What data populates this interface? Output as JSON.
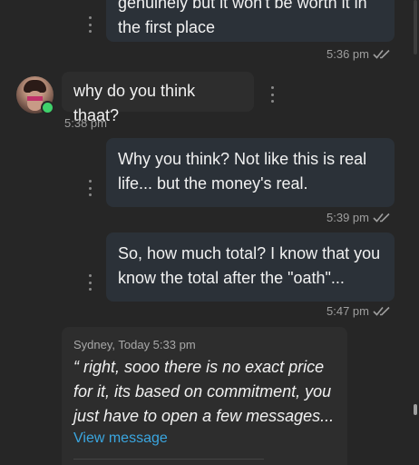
{
  "messages": [
    {
      "id": "m1",
      "direction": "outgoing",
      "text": "genuinely but it won't be worth it in\nthe first place",
      "time": "5:36 pm",
      "status": "read"
    },
    {
      "id": "m2",
      "direction": "incoming",
      "text": "why do you think thaat?",
      "time": "5:38 pm"
    },
    {
      "id": "m3",
      "direction": "outgoing",
      "text": "Why you think? Not like this is real\nlife... but the money's real.",
      "time": "5:39 pm",
      "status": "read"
    },
    {
      "id": "m4",
      "direction": "outgoing",
      "text": "So, how much total? I know that you\nknow the total after the \"oath\"...",
      "time": "5:47 pm",
      "status": "read"
    }
  ],
  "quote": {
    "header": "Sydney, Today 5:33 pm",
    "text": "“ right, sooo there is no exact price\nfor it, its based on commitment, you\njust have to open a few messages...",
    "link_label": "View message"
  },
  "contact": {
    "online": true
  },
  "colors": {
    "background": "#262626",
    "outgoing_bubble": "#2b3138",
    "incoming_bubble": "#2d2d2d",
    "link": "#3aa6e0",
    "online": "#3fd16b"
  },
  "icons": {
    "more": "kebab-vertical",
    "read_receipt": "double-check"
  }
}
